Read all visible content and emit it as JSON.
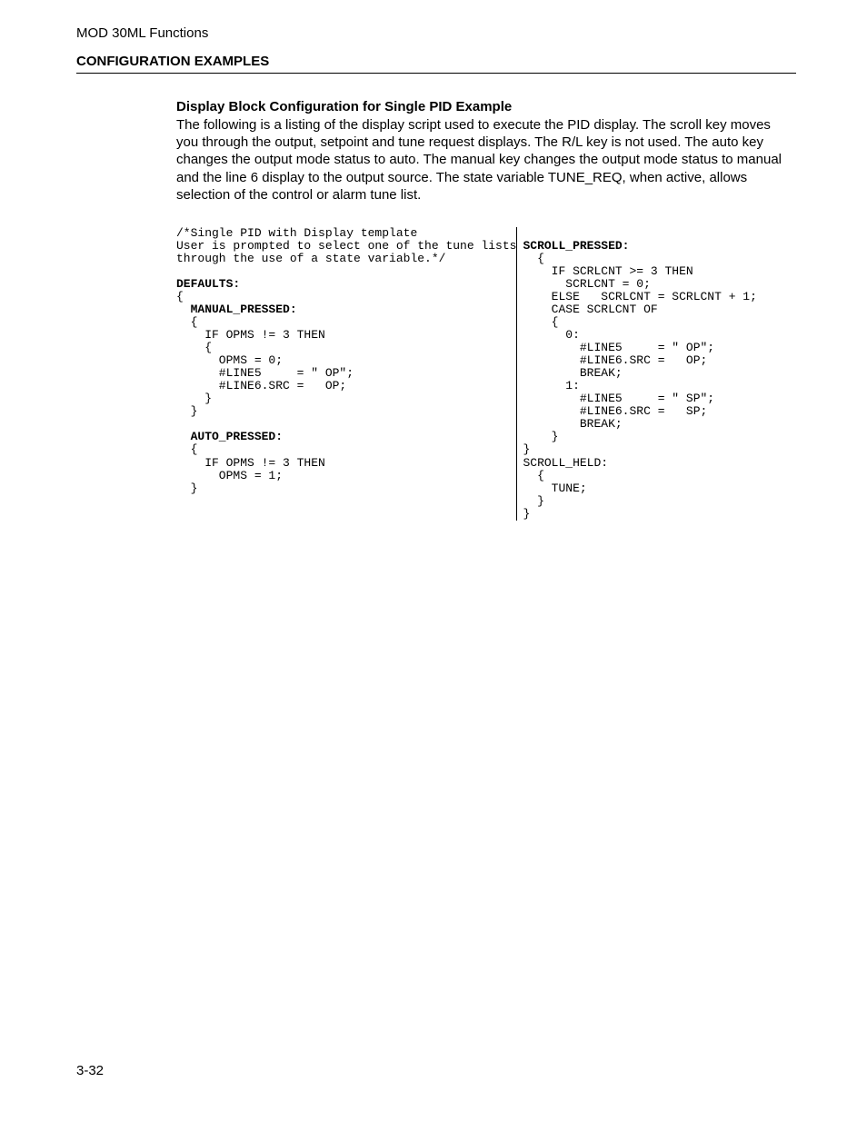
{
  "header": {
    "running_head": "MOD 30ML Functions",
    "section_title": "CONFIGURATION EXAMPLES"
  },
  "content": {
    "sub_title": "Display Block Configuration for Single PID Example",
    "paragraph": "The following is a listing of the display script used to execute the PID display. The scroll key moves you through the output, setpoint and tune request displays. The R/L key is not used. The auto key changes the output mode status to auto. The manual key changes the output mode status to manual and the line 6 display to the output source. The state variable TUNE_REQ, when active, allows selection of the control or alarm tune list."
  },
  "code": {
    "left": {
      "l01": "/*Single PID with Display template",
      "l02": "User is prompted to select one of the tune lists",
      "l03": "through the use of a state variable.*/",
      "l04": "",
      "l05": "DEFAULTS:",
      "l06": "{",
      "l07": "  MANUAL_PRESSED:",
      "l08": "  {",
      "l09": "    IF OPMS != 3 THEN",
      "l10": "    {",
      "l11": "      OPMS = 0;",
      "l12": "      #LINE5     = \" OP\";",
      "l13": "      #LINE6.SRC =   OP;",
      "l14": "    }",
      "l15": "  }",
      "l16": "",
      "l17": "  AUTO_PRESSED:",
      "l18": "  {",
      "l19": "    IF OPMS != 3 THEN",
      "l20": "      OPMS = 1;",
      "l21": "  }"
    },
    "right": {
      "r00": "",
      "r01": "SCROLL_PRESSED:",
      "r02": "  {",
      "r03": "    IF SCRLCNT >= 3 THEN",
      "r04": "      SCRLCNT = 0;",
      "r05": "    ELSE   SCRLCNT = SCRLCNT + 1;",
      "r06": "    CASE SCRLCNT OF",
      "r07": "    {",
      "r08": "      0:",
      "r09": "        #LINE5     = \" OP\";",
      "r10": "        #LINE6.SRC =   OP;",
      "r11": "        BREAK;",
      "r12": "      1:",
      "r13": "        #LINE5     = \" SP\";",
      "r14": "        #LINE6.SRC =   SP;",
      "r15": "        BREAK;",
      "r16": "    }",
      "r17": "}",
      "r18": "SCROLL_HELD:",
      "r19": "  {",
      "r20": "    TUNE;",
      "r21": "  }",
      "r22": "}"
    }
  },
  "footer": {
    "page_number": "3-32"
  }
}
